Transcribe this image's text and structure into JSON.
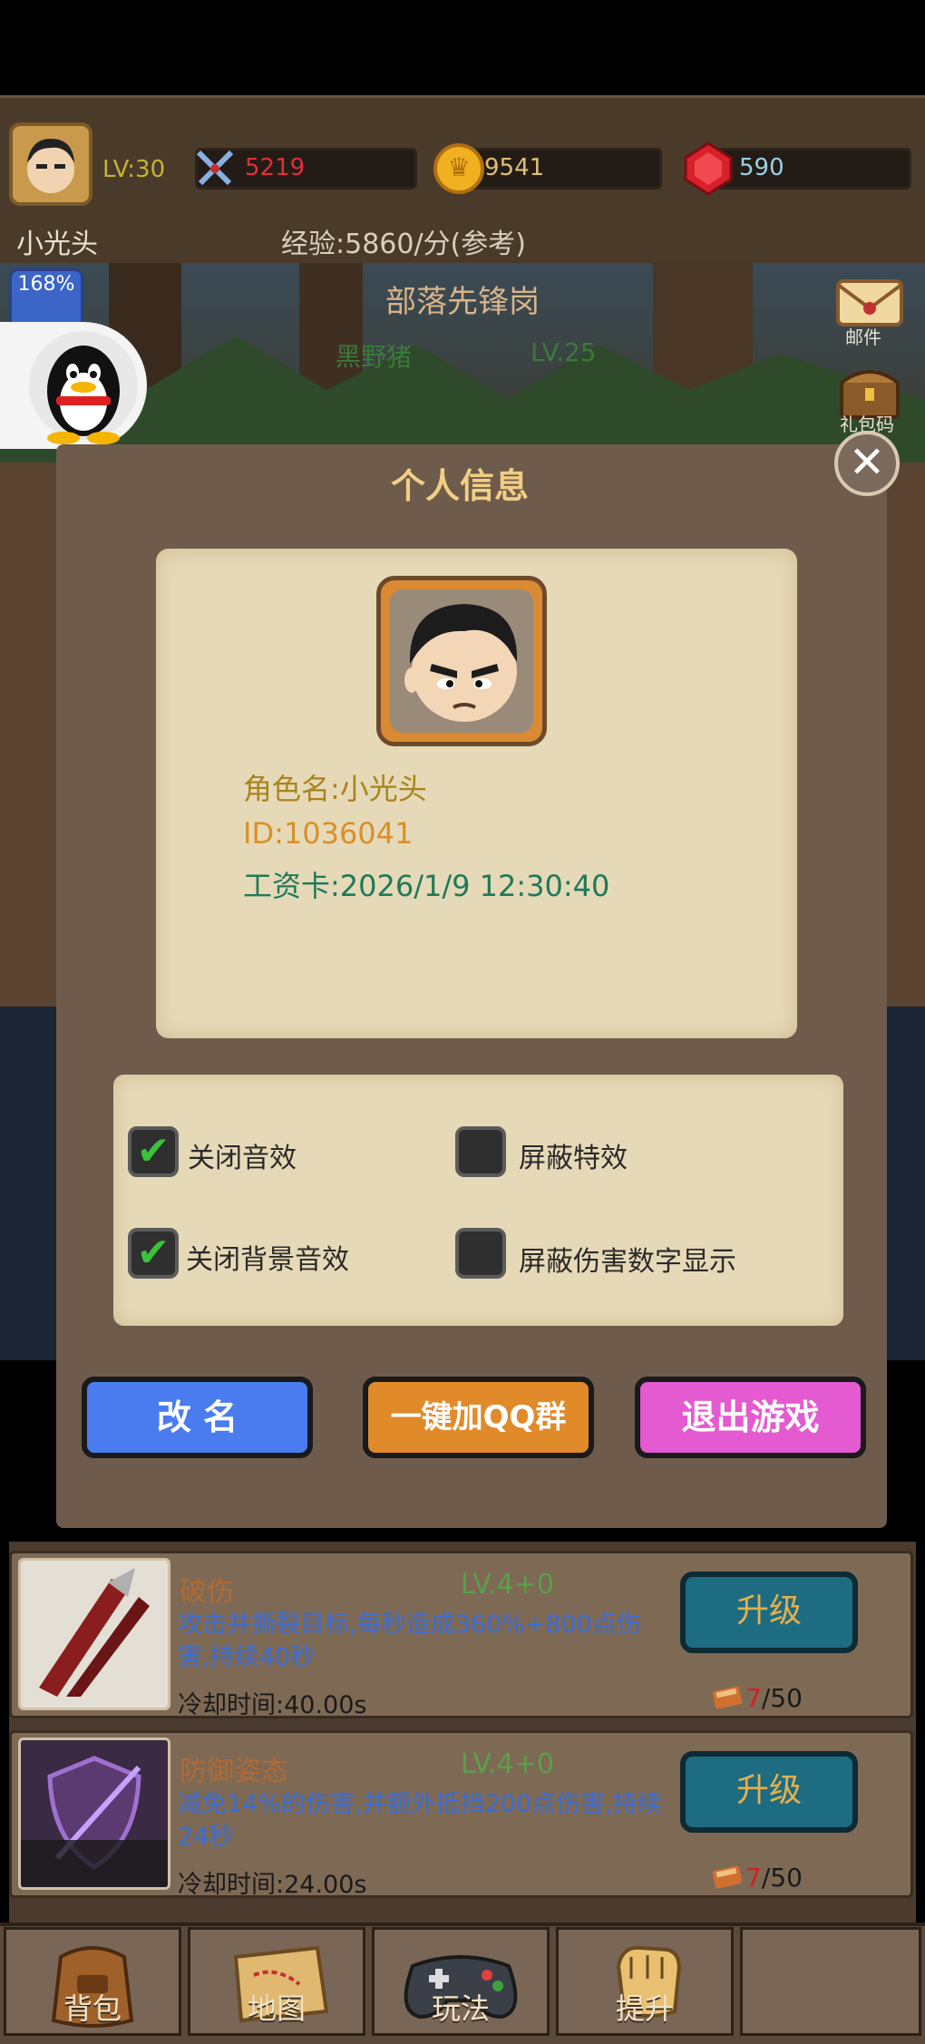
{
  "status_bar": {
    "player_name": "小光头",
    "level": "LV:30",
    "power": "5219",
    "gold": "9541",
    "gems": "590",
    "exp_rate": "经验:5860/分(参考)"
  },
  "scene": {
    "stage_name": "部落先锋岗",
    "enemy_name": "黑野猪",
    "enemy_level": "LV.25",
    "exp_boost": "168%",
    "side_mail": "邮件",
    "side_gift": "礼包码"
  },
  "dialog": {
    "title": "个人信息",
    "close_symbol": "✕",
    "role_name": "角色名:小光头",
    "id": "ID:1036041",
    "wage_card": "工资卡:2026/1/9 12:30:40",
    "options": [
      {
        "label": "关闭音效",
        "checked": true
      },
      {
        "label": "屏蔽特效",
        "checked": false
      },
      {
        "label": "关闭背景音效",
        "checked": true
      },
      {
        "label": "屏蔽伤害数字显示",
        "checked": false
      }
    ],
    "buttons": {
      "rename": "改 名",
      "join_qq": "一键加QQ群",
      "exit": "退出游戏"
    }
  },
  "skills": [
    {
      "name": "破伤",
      "level": "LV.4+0",
      "desc": "攻击并撕裂目标,每秒造成360%+800点伤害,持续40秒",
      "cooldown": "冷却时间:40.00s",
      "upgrade": "升级",
      "cost_have": "7",
      "cost_need": "/50"
    },
    {
      "name": "防御姿态",
      "level": "LV.4+0",
      "desc": "减免14%的伤害,并额外抵挡200点伤害,持续24秒",
      "cooldown": "冷却时间:24.00s",
      "upgrade": "升级",
      "cost_have": "7",
      "cost_need": "/50"
    }
  ],
  "bottom_nav": [
    "背包",
    "地图",
    "玩法",
    "提升"
  ],
  "colors": {
    "rename_button": "#4a7cf0",
    "qq_button": "#e08a2a",
    "exit_button": "#e45ad0",
    "dialog_bg": "#6e5b4b",
    "paper": "#e6d9b7"
  }
}
